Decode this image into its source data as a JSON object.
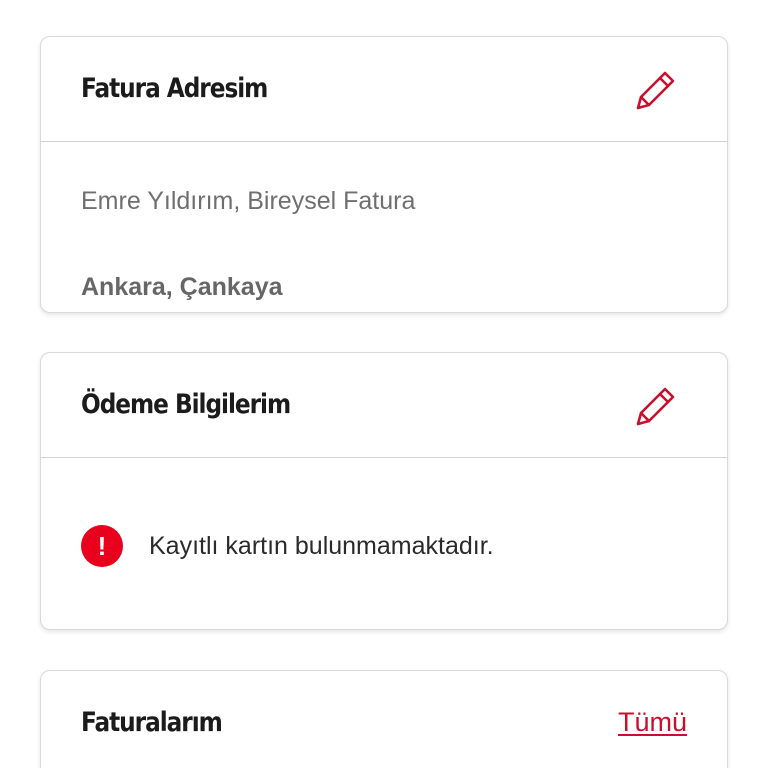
{
  "billing_card": {
    "title": "Fatura Adresim",
    "edit_icon": "pencil-icon",
    "name_line": "Emre Yıldırım, Bireysel Fatura",
    "city_line": "Ankara, Çankaya"
  },
  "payment_card": {
    "title": "Ödeme Bilgilerim",
    "edit_icon": "pencil-icon",
    "alert_icon": "exclamation-circle-icon",
    "alert_glyph": "!",
    "notice": "Kayıtlı kartın bulunmamaktadır."
  },
  "invoices_card": {
    "title": "Faturalarım",
    "see_all": "Tümü"
  },
  "colors": {
    "accent": "#c8102e",
    "alert": "#e8001c",
    "title_text": "#1b1b1b",
    "muted_text": "#6f6f6f"
  }
}
